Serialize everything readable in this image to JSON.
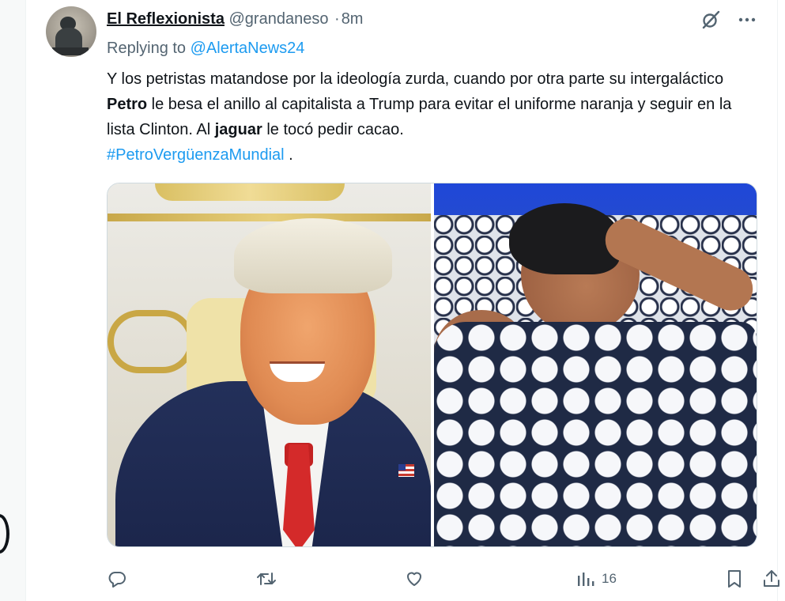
{
  "tweet": {
    "author": {
      "display_name": "El Reflexionista",
      "handle": "@grandaneso",
      "separator": "·",
      "time": "8m",
      "avatar_icon": "thinker-statue-avatar"
    },
    "reply_to": {
      "prefix": "Replying to",
      "mention": "@AlertaNews24"
    },
    "text": {
      "part1": "Y los petristas matandose por la ideología zurda, cuando por otra parte su intergaláctico ",
      "bold1": "Petro",
      "part2": " le besa el anillo al capitalista a Trump para evitar el uniforme naranja y seguir en la lista Clinton. Al ",
      "bold2": "jaguar",
      "part3": " le tocó pedir cacao.",
      "hashtag": "#PetroVergüenzaMundial",
      "trailing": " ."
    },
    "media": [
      {
        "name": "smiling-man-in-suit-photo"
      },
      {
        "name": "man-sleeping-under-blanket-photo"
      }
    ],
    "header_icons": [
      "grok-icon",
      "more-icon"
    ],
    "actions": {
      "reply_icon": "reply-icon",
      "retweet_icon": "retweet-icon",
      "like_icon": "like-icon",
      "views_icon": "views-icon",
      "views_count": "16",
      "bookmark_icon": "bookmark-icon",
      "share_icon": "share-icon"
    }
  },
  "colors": {
    "link": "#1d9bf0",
    "secondary_text": "#536471",
    "primary_text": "#0f1419"
  }
}
